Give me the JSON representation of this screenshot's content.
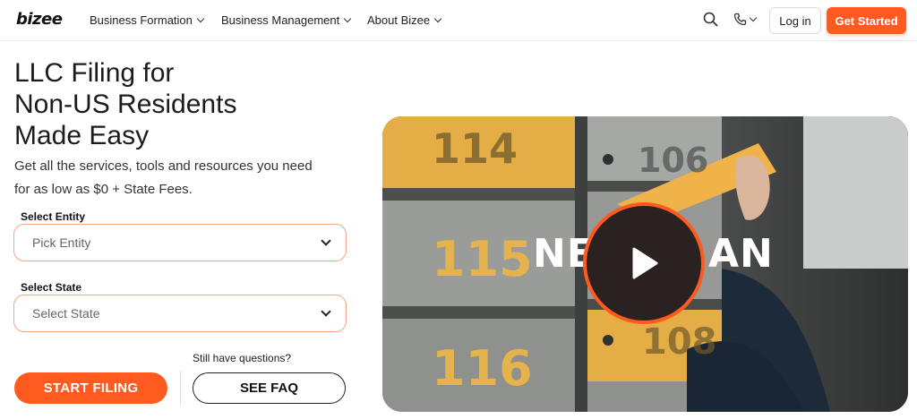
{
  "nav": {
    "logo": "bizee",
    "menu": [
      {
        "label": "Business Formation"
      },
      {
        "label": "Business Management"
      },
      {
        "label": "About Bizee"
      }
    ],
    "search_icon": "search-icon",
    "phone_icon": "phone-icon",
    "login_label": "Log in",
    "get_started_label": "Get Started"
  },
  "hero": {
    "title_line1": "LLC Filing for",
    "title_line2": "Non-US Residents",
    "title_line3": "Made Easy",
    "subtitle_line1": "Get all the services, tools and resources you need",
    "subtitle_line2": "for as low as $0 + State Fees."
  },
  "form": {
    "entity_label": "Select Entity",
    "entity_placeholder": "Pick Entity",
    "state_label": "Select State",
    "state_placeholder": "Select State"
  },
  "cta": {
    "start_label": "START FILING",
    "questions_text": "Still have questions?",
    "faq_label": "SEE FAQ"
  },
  "video": {
    "overlay_left": "NE",
    "overlay_right": "AN",
    "mailbox_numbers": [
      "114",
      "106",
      "115",
      "116",
      "108"
    ],
    "play_icon": "play-icon"
  },
  "colors": {
    "accent": "#ff5a1f",
    "select_border": "#f4a482",
    "mailbox_yellow": "#e8b04a",
    "mailbox_grey": "#8d8f8c"
  }
}
